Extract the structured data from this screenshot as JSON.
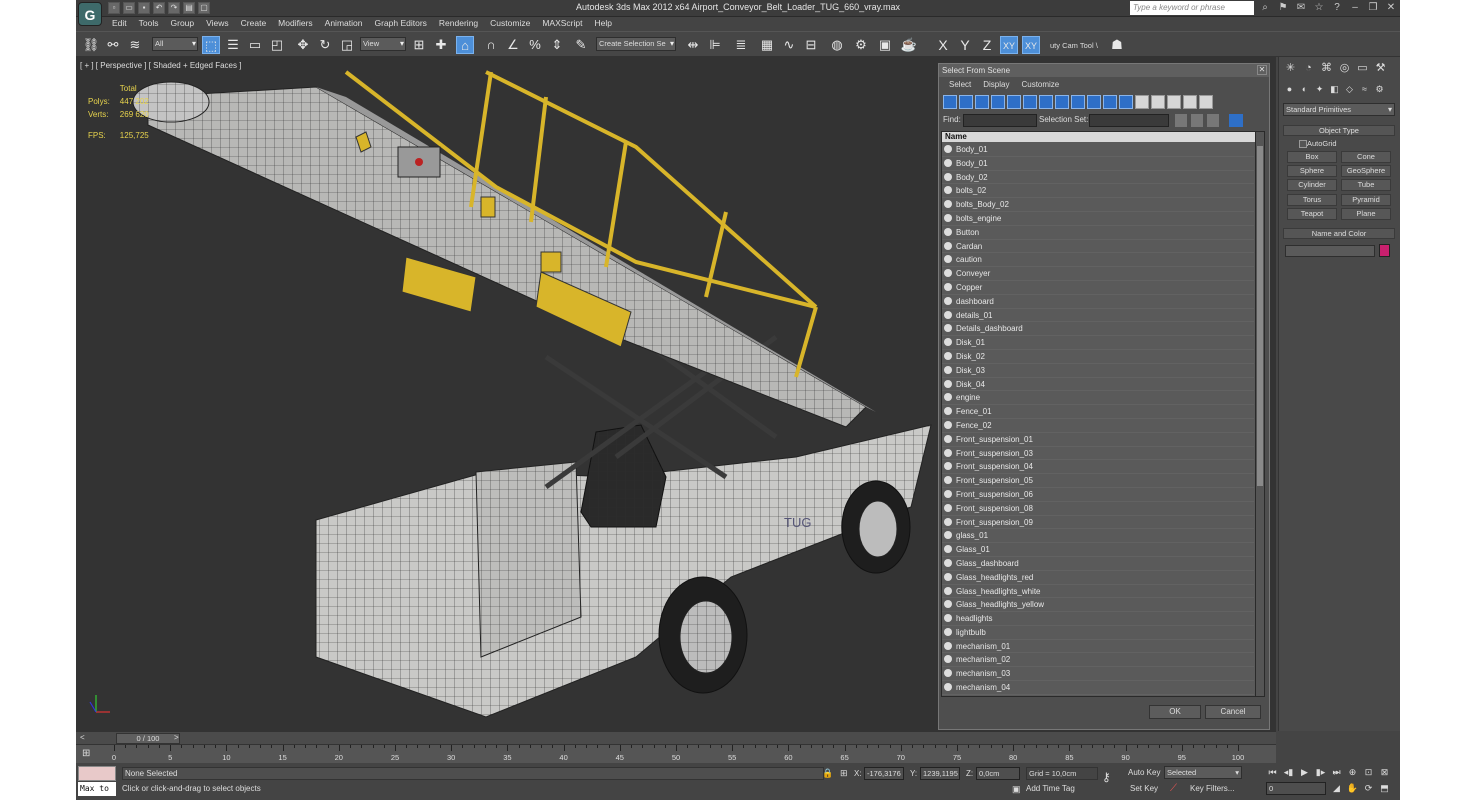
{
  "window": {
    "title": "Autodesk 3ds Max  2012 x64     Airport_Conveyor_Belt_Loader_TUG_660_vray.max",
    "search_placeholder": "Type a keyword or phrase",
    "logo": "G"
  },
  "menu": [
    "Edit",
    "Tools",
    "Group",
    "Views",
    "Create",
    "Modifiers",
    "Animation",
    "Graph Editors",
    "Rendering",
    "Customize",
    "MAXScript",
    "Help"
  ],
  "toolbar": {
    "filter": "All",
    "refcoord": "View",
    "named_selection": "Create Selection Se",
    "axes": [
      "X",
      "Y",
      "Z",
      "XY",
      "XY"
    ],
    "cam_tool": "uty Cam Tool \\"
  },
  "viewport": {
    "label": "[ + ] [ Perspective ] [ Shaded + Edged Faces ]",
    "stats": {
      "total_label": "Total",
      "polys_label": "Polys:",
      "polys": "447 202",
      "verts_label": "Verts:",
      "verts": "269 620",
      "fps_label": "FPS:",
      "fps": "125,725"
    }
  },
  "dialog": {
    "title": "Select From Scene",
    "menu": [
      "Select",
      "Display",
      "Customize"
    ],
    "find_label": "Find:",
    "selset_label": "Selection Set:",
    "column": "Name",
    "items": [
      "Body_01",
      "Body_01",
      "Body_02",
      "bolts_02",
      "bolts_Body_02",
      "bolts_engine",
      "Button",
      "Cardan",
      "caution",
      "Conveyer",
      "Copper",
      "dashboard",
      "details_01",
      "Details_dashboard",
      "Disk_01",
      "Disk_02",
      "Disk_03",
      "Disk_04",
      "engine",
      "Fence_01",
      "Fence_02",
      "Front_suspension_01",
      "Front_suspension_03",
      "Front_suspension_04",
      "Front_suspension_05",
      "Front_suspension_06",
      "Front_suspension_08",
      "Front_suspension_09",
      "glass_01",
      "Glass_01",
      "Glass_dashboard",
      "Glass_headlights_red",
      "Glass_headlights_white",
      "Glass_headlights_yellow",
      "headlights",
      "lightbulb",
      "mechanism_01",
      "mechanism_02",
      "mechanism_03",
      "mechanism_04"
    ],
    "ok": "OK",
    "cancel": "Cancel"
  },
  "command_panel": {
    "dropdown": "Standard Primitives",
    "object_type": "Object Type",
    "autogrid": "AutoGrid",
    "buttons": [
      "Box",
      "Cone",
      "Sphere",
      "GeoSphere",
      "Cylinder",
      "Tube",
      "Torus",
      "Pyramid",
      "Teapot",
      "Plane"
    ],
    "name_color": "Name and Color",
    "swatch_color": "#c8206e"
  },
  "timeline": {
    "slider": "0 / 100",
    "prev": "<",
    "next": ">",
    "ticks": [
      "0",
      "5",
      "10",
      "15",
      "20",
      "25",
      "30",
      "35",
      "40",
      "45",
      "50",
      "55",
      "60",
      "65",
      "70",
      "75",
      "80",
      "85",
      "90",
      "95",
      "100"
    ]
  },
  "status": {
    "maxscript": "Max to",
    "selection": "None Selected",
    "prompt": "Click or click-and-drag to select objects",
    "x_label": "X:",
    "x": "-176,3176",
    "y_label": "Y:",
    "y": "1239,1195",
    "z_label": "Z:",
    "z": "0,0cm",
    "grid": "Grid = 10,0cm",
    "add_time_tag": "Add Time Tag",
    "auto_key": "Auto Key",
    "set_key": "Set Key",
    "selected": "Selected",
    "key_filters": "Key Filters...",
    "frame": "0"
  }
}
